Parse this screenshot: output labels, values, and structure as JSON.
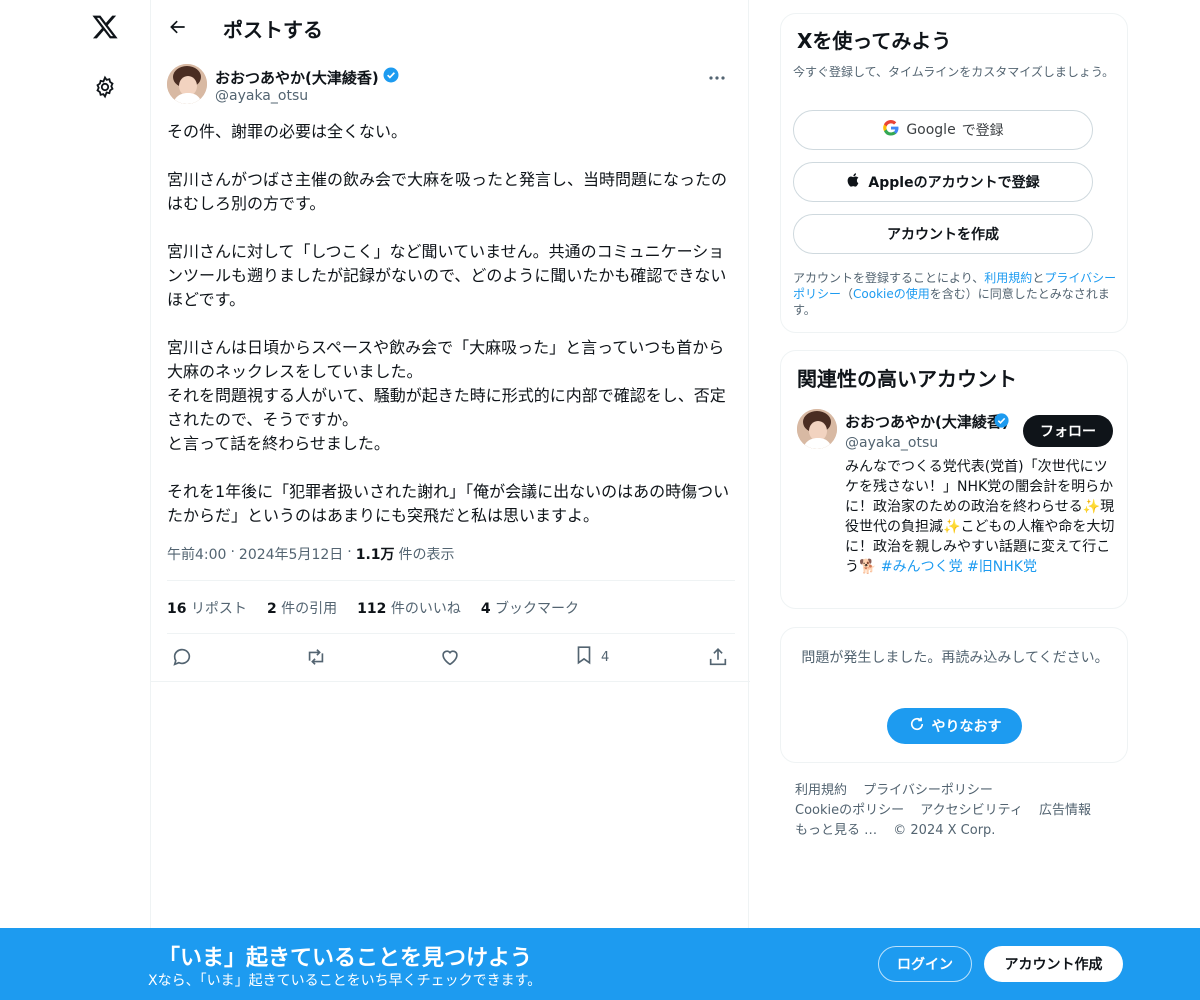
{
  "header": {
    "title": "ポストする"
  },
  "post": {
    "author_name": "おおつあやか(大津綾香)",
    "author_handle": "@ayaka_otsu",
    "text": "その件、謝罪の必要は全くない。\n\n宮川さんがつばさ主催の飲み会で大麻を吸ったと発言し、当時問題になったのはむしろ別の方です。\n\n宮川さんに対して「しつこく」など聞いていません。共通のコミュニケーションツールも遡りましたが記録がないので、どのように聞いたかも確認できないほどです。\n\n宮川さんは日頃からスペースや飲み会で「大麻吸った」と言っていつも首から大麻のネックレスをしていました。\nそれを問題視する人がいて、騒動が起きた時に形式的に内部で確認をし、否定されたので、そうですか。\nと言って話を終わらせました。\n\nそれを1年後に「犯罪者扱いされた謝れ」「俺が会議に出ないのはあの時傷ついたからだ」というのはあまりにも突飛だと私は思いますよ。",
    "time": "午前4:00",
    "date": "2024年5月12日",
    "views_count": "1.1万",
    "views_label": "件の表示",
    "stats": {
      "reposts_count": "16",
      "reposts_label": "リポスト",
      "quotes_count": "2",
      "quotes_label": "件の引用",
      "likes_count": "112",
      "likes_label": "件のいいね",
      "bookmarks_count": "4",
      "bookmarks_label": "ブックマーク"
    },
    "bookmark_action_count": "4"
  },
  "signup_card": {
    "title": "Xを使ってみよう",
    "subtitle": "今すぐ登録して、タイムラインをカスタマイズしましょう。",
    "google_label": "Google",
    "google_suffix": "で登録",
    "apple_label": "Appleのアカウントで登録",
    "create_label": "アカウントを作成",
    "legal_prefix": "アカウントを登録することにより、",
    "legal_terms": "利用規約",
    "legal_and": "と",
    "legal_privacy": "プライバシーポリシー",
    "legal_open": "（",
    "legal_cookie": "Cookieの使用",
    "legal_suffix": "を含む）に同意したとみなされます。"
  },
  "relevant": {
    "title": "関連性の高いアカウント",
    "name": "おおつあやか(大津綾香)",
    "handle": "@ayaka_otsu",
    "follow_label": "フォロー",
    "bio_1": "みんなでつくる党代表(党首)「次世代にツケを残さない！」NHK党の闇会計を明らかに！政治家のための政治を終わらせる",
    "bio_sparkle_1": "✨",
    "bio_2": "現役世代の負担減",
    "bio_sparkle_2": "✨",
    "bio_3": "こどもの人権や命を大切に！政治を親しみやすい話題に変えて行こう",
    "bio_dog": "🐕",
    "bio_tags": "#みんつく党 #旧NHK党"
  },
  "error_card": {
    "message": "問題が発生しました。再読み込みしてください。",
    "retry_label": "やりなおす"
  },
  "footer": {
    "terms": "利用規約",
    "privacy": "プライバシーポリシー",
    "cookie": "Cookieのポリシー",
    "accessibility": "アクセシビリティ",
    "ads": "広告情報",
    "more": "もっと見る …",
    "copyright": "© 2024 X Corp."
  },
  "banner": {
    "title": "「いま」起きていることを見つけよう",
    "subtitle": "Xなら、「いま」起きていることをいち早くチェックできます。",
    "login_label": "ログイン",
    "signup_label": "アカウント作成"
  },
  "colors": {
    "accent": "#1d9bf0",
    "text_primary": "#0f1419",
    "text_secondary": "#536471",
    "border": "#eff3f4"
  }
}
